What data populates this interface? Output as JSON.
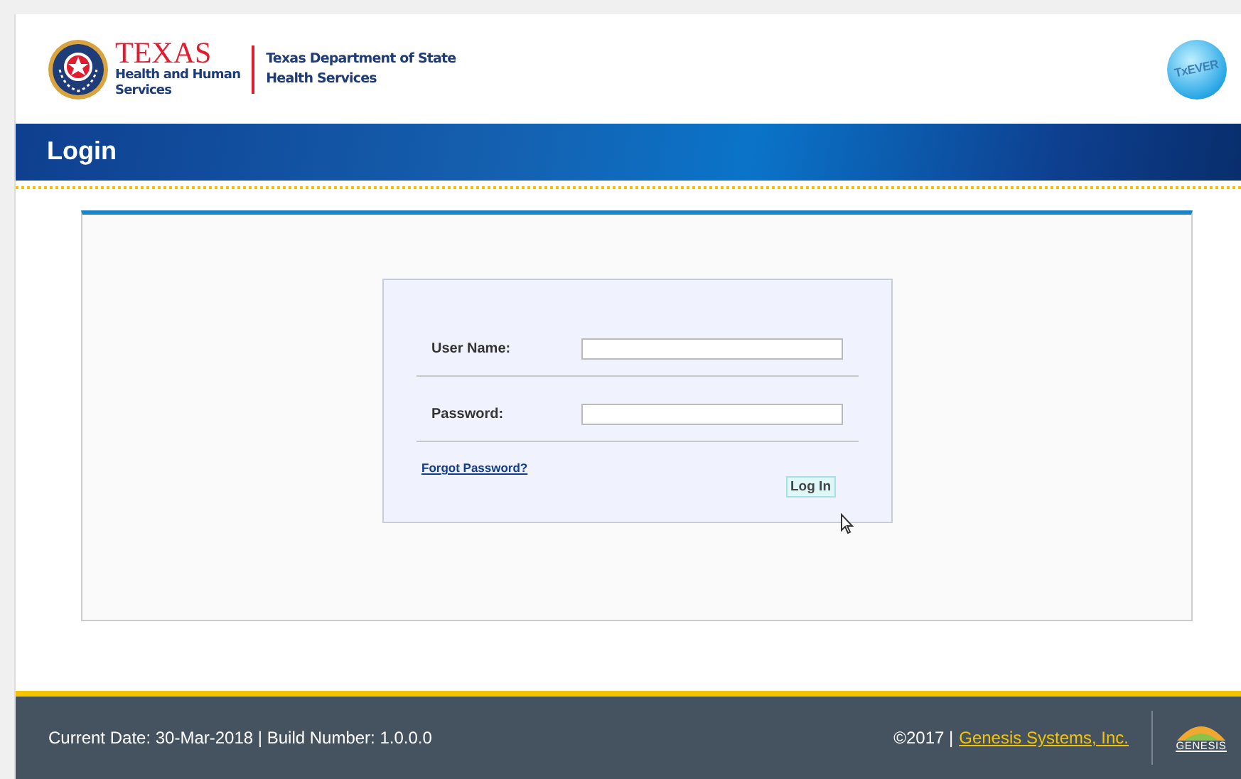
{
  "header": {
    "agency_logo": {
      "title": "TEXAS",
      "subtitle_lines": [
        "Health and Human",
        "Services"
      ]
    },
    "department_lines": [
      "Texas Department of State",
      "Health Services"
    ],
    "app_logo": {
      "text": "TxEVER"
    }
  },
  "banner": {
    "title": "Login"
  },
  "login_form": {
    "fields": [
      {
        "label": "User Name:"
      },
      {
        "label": "Password:"
      }
    ],
    "forgot_link": "Forgot Password?",
    "submit_button": "Log In"
  },
  "footer": {
    "info": "Current Date: 30-Mar-2018 | Build Number: 1.0.0.0",
    "copyright": "©2017 |",
    "company_link": "Genesis Systems, Inc.",
    "company_logo": {
      "text": "GENESIS"
    }
  }
}
